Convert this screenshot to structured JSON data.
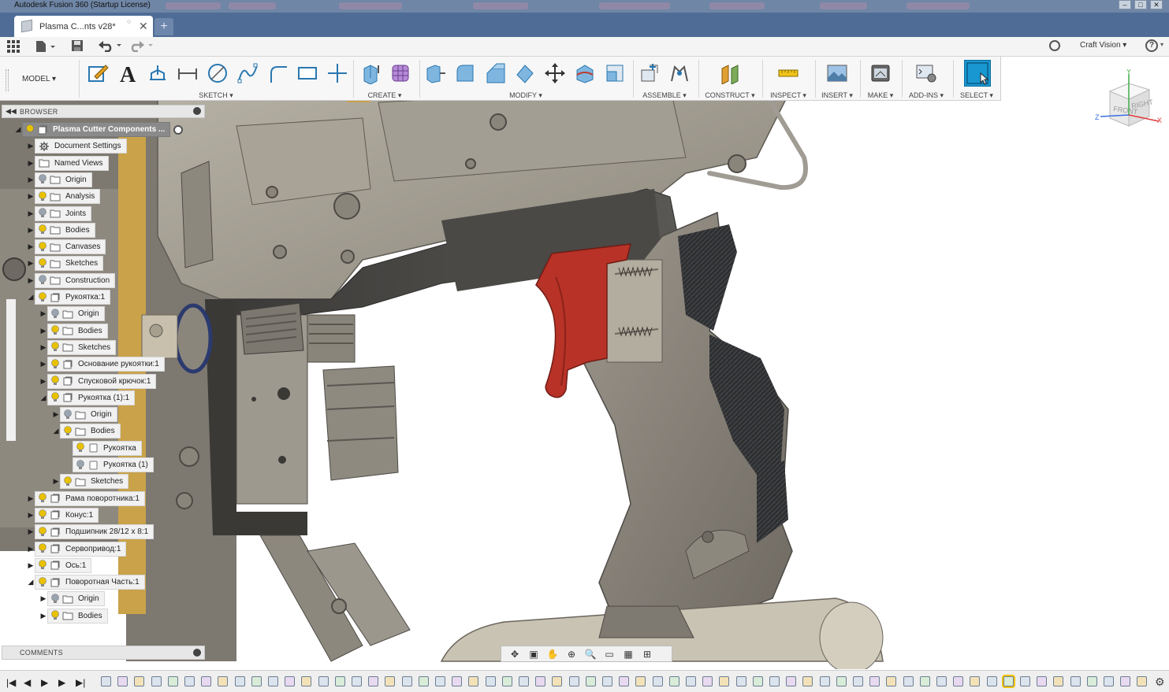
{
  "window": {
    "title": "Autodesk Fusion 360 (Startup License)"
  },
  "tab": {
    "label": "Plasma C...nts v28*",
    "close": "✕",
    "new_tab": "+"
  },
  "quick_access": {
    "user": "Craft Vision",
    "help": "?"
  },
  "ribbon": {
    "workspace": "MODEL",
    "groups": [
      {
        "label": "SKETCH"
      },
      {
        "label": "CREATE"
      },
      {
        "label": "MODIFY"
      },
      {
        "label": "ASSEMBLE"
      },
      {
        "label": "CONSTRUCT"
      },
      {
        "label": "INSPECT"
      },
      {
        "label": "INSERT"
      },
      {
        "label": "MAKE"
      },
      {
        "label": "ADD-INS"
      },
      {
        "label": "SELECT"
      }
    ]
  },
  "viewcube": {
    "front": "FRONT",
    "right": "RIGHT",
    "axis_x": "X",
    "axis_y": "Y",
    "axis_z": "Z"
  },
  "browser": {
    "title": "BROWSER",
    "nodes": [
      {
        "label": "Plasma Cutter Components ...",
        "depth": 0,
        "expander": "◢",
        "icon": "component-icon",
        "bulb": true,
        "root": true
      },
      {
        "label": "Document Settings",
        "depth": 1,
        "expander": "▶",
        "icon": "gear-icon",
        "bulb": false
      },
      {
        "label": "Named Views",
        "depth": 1,
        "expander": "▶",
        "icon": "folder-icon",
        "bulb": false
      },
      {
        "label": "Origin",
        "depth": 1,
        "expander": "▶",
        "icon": "folder-icon",
        "bulb": true,
        "dim": true
      },
      {
        "label": "Analysis",
        "depth": 1,
        "expander": "▶",
        "icon": "folder-icon",
        "bulb": true
      },
      {
        "label": "Joints",
        "depth": 1,
        "expander": "▶",
        "icon": "folder-icon",
        "bulb": true,
        "dim": true
      },
      {
        "label": "Bodies",
        "depth": 1,
        "expander": "▶",
        "icon": "folder-icon",
        "bulb": true
      },
      {
        "label": "Canvases",
        "depth": 1,
        "expander": "▶",
        "icon": "folder-icon",
        "bulb": true
      },
      {
        "label": "Sketches",
        "depth": 1,
        "expander": "▶",
        "icon": "folder-icon",
        "bulb": true
      },
      {
        "label": "Construction",
        "depth": 1,
        "expander": "▶",
        "icon": "folder-icon",
        "bulb": true,
        "dim": true
      },
      {
        "label": "Рукоятка:1",
        "depth": 1,
        "expander": "◢",
        "icon": "component-icon",
        "bulb": true
      },
      {
        "label": "Origin",
        "depth": 2,
        "expander": "▶",
        "icon": "folder-icon",
        "bulb": true,
        "dim": true
      },
      {
        "label": "Bodies",
        "depth": 2,
        "expander": "▶",
        "icon": "folder-icon",
        "bulb": true
      },
      {
        "label": "Sketches",
        "depth": 2,
        "expander": "▶",
        "icon": "folder-icon",
        "bulb": true
      },
      {
        "label": "Основание рукоятки:1",
        "depth": 2,
        "expander": "▶",
        "icon": "component-icon",
        "bulb": true
      },
      {
        "label": "Спусковой крючок:1",
        "depth": 2,
        "expander": "▶",
        "icon": "component-icon",
        "bulb": true
      },
      {
        "label": "Рукоятка (1):1",
        "depth": 2,
        "expander": "◢",
        "icon": "component-icon",
        "bulb": true
      },
      {
        "label": "Origin",
        "depth": 3,
        "expander": "▶",
        "icon": "folder-icon",
        "bulb": true,
        "dim": true
      },
      {
        "label": "Bodies",
        "depth": 3,
        "expander": "◢",
        "icon": "folder-icon",
        "bulb": true
      },
      {
        "label": "Рукоятка",
        "depth": 4,
        "expander": "",
        "icon": "body-icon",
        "bulb": true
      },
      {
        "label": "Рукоятка (1)",
        "depth": 4,
        "expander": "",
        "icon": "body-icon",
        "bulb": true,
        "dim": true
      },
      {
        "label": "Sketches",
        "depth": 3,
        "expander": "▶",
        "icon": "folder-icon",
        "bulb": true
      },
      {
        "label": "Рама поворотника:1",
        "depth": 1,
        "expander": "▶",
        "icon": "component-icon",
        "bulb": true
      },
      {
        "label": "Конус:1",
        "depth": 1,
        "expander": "▶",
        "icon": "component-icon",
        "bulb": true
      },
      {
        "label": "Подшипник 28/12 x 8:1",
        "depth": 1,
        "expander": "▶",
        "icon": "component-icon",
        "bulb": true
      },
      {
        "label": "Сервопривод:1",
        "depth": 1,
        "expander": "▶",
        "icon": "component-icon",
        "bulb": true
      },
      {
        "label": "Ось:1",
        "depth": 1,
        "expander": "▶",
        "icon": "component-icon",
        "bulb": true
      },
      {
        "label": "Поворотная Часть:1",
        "depth": 1,
        "expander": "◢",
        "icon": "component-icon",
        "bulb": true
      },
      {
        "label": "Origin",
        "depth": 2,
        "expander": "▶",
        "icon": "folder-icon",
        "bulb": true,
        "dim": true
      },
      {
        "label": "Bodies",
        "depth": 2,
        "expander": "▶",
        "icon": "folder-icon",
        "bulb": true
      }
    ]
  },
  "comments": {
    "title": "COMMENTS"
  },
  "colors": {
    "accent": "#1997d0",
    "trigger": "#b83228",
    "bulb_on": "#e8c100",
    "bulb_off": "#9aa4b0"
  }
}
